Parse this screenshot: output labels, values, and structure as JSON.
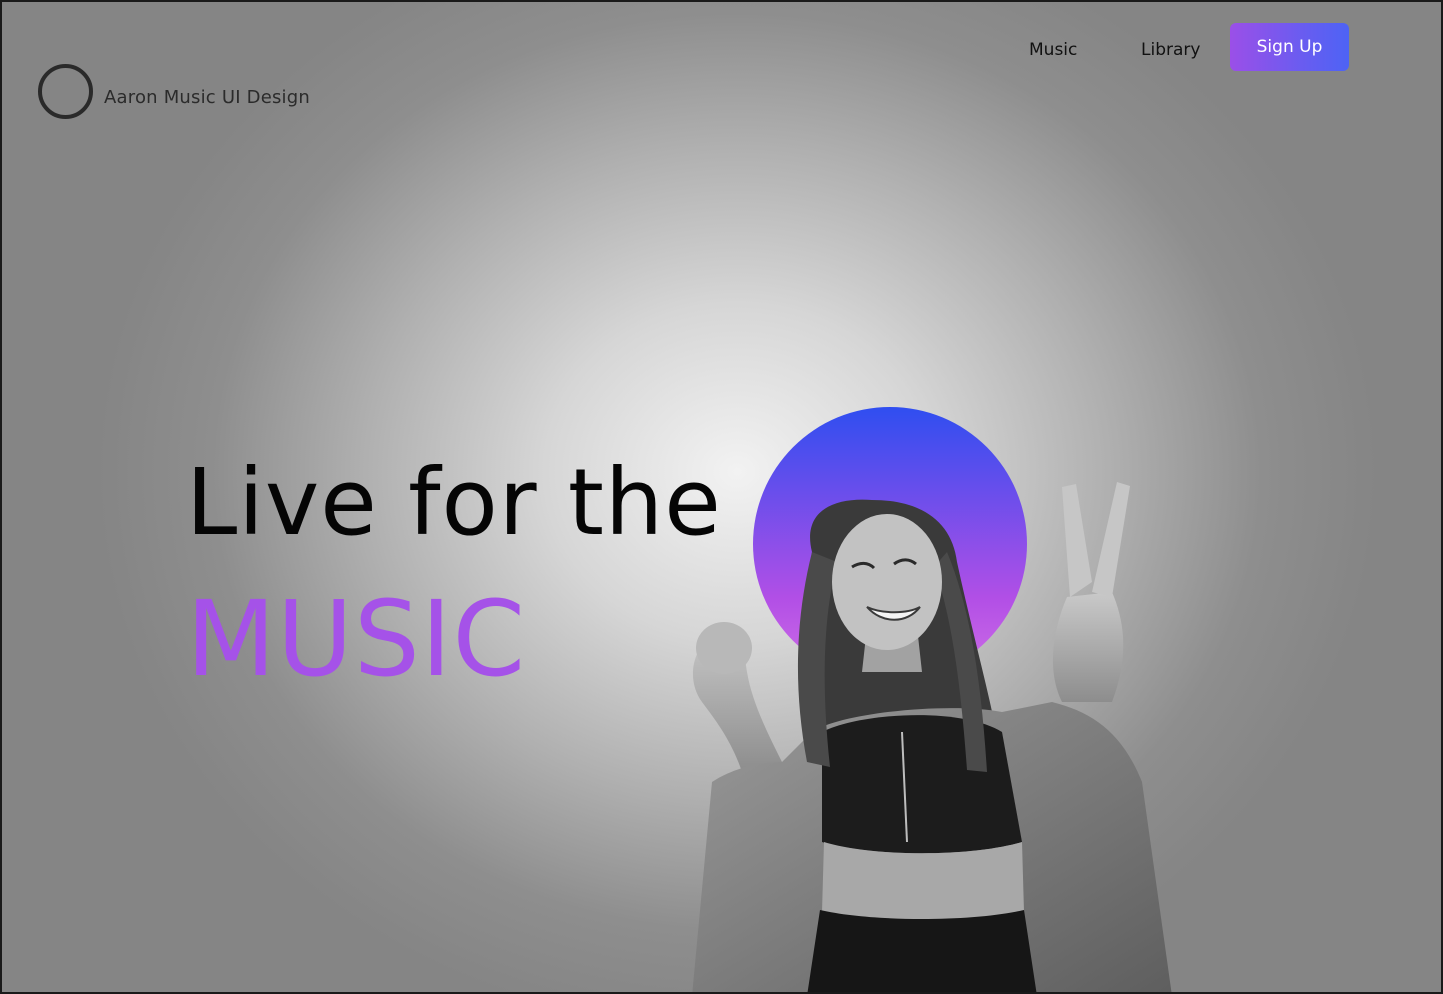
{
  "brand": {
    "name": "Aaron Music UI Design",
    "logo_icon": "ring-logo-icon"
  },
  "nav": {
    "links": [
      {
        "label": "Music"
      },
      {
        "label": "Library"
      }
    ],
    "signup_label": "Sign Up"
  },
  "hero": {
    "line1": "Live for the",
    "line2": "MUSIC",
    "image": "smiling-woman-peace-sign-photo"
  },
  "colors": {
    "accent_purple": "#a552e8",
    "button_gradient_start": "#9b4fe8",
    "button_gradient_end": "#4d63f5",
    "halo_top": "#2f4ef0",
    "halo_bottom": "#b24fe6"
  }
}
